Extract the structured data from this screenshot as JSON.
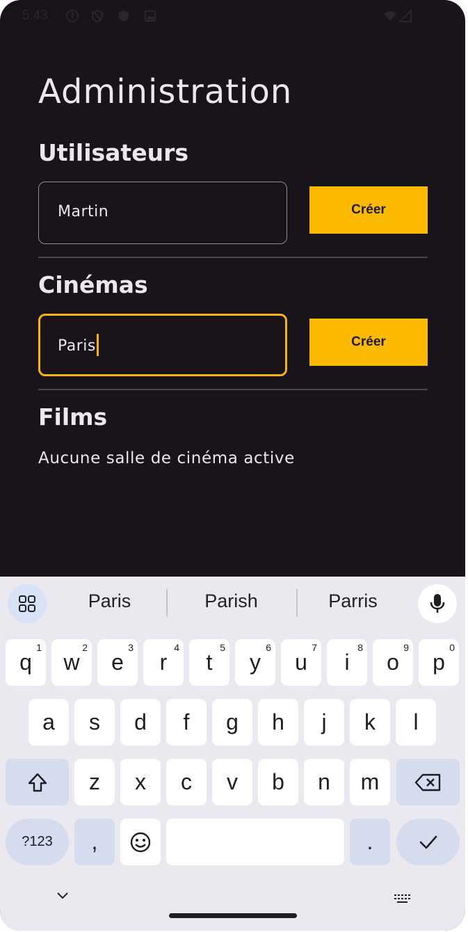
{
  "status_bar": {
    "time": "5:43",
    "icons": [
      "info-circle-icon",
      "shield-icon",
      "vpn-shield-icon",
      "photo-icon",
      "wifi-icon",
      "signal-icon"
    ]
  },
  "app": {
    "title": "Administration",
    "sections": {
      "users": {
        "title": "Utilisateurs",
        "input_value": "Martin",
        "button_label": "Créer"
      },
      "cinemas": {
        "title": "Cinémas",
        "input_value": "Paris",
        "button_label": "Créer"
      },
      "films": {
        "title": "Films",
        "empty_message": "Aucune salle de cinéma active"
      }
    },
    "colors": {
      "background": "#18141a",
      "accent": "#fbba00",
      "focus_border": "#f4b60b"
    }
  },
  "keyboard": {
    "suggestions": [
      "Paris",
      "Parish",
      "Parris"
    ],
    "row1": [
      {
        "key": "q",
        "hint": "1"
      },
      {
        "key": "w",
        "hint": "2"
      },
      {
        "key": "e",
        "hint": "3"
      },
      {
        "key": "r",
        "hint": "4"
      },
      {
        "key": "t",
        "hint": "5"
      },
      {
        "key": "y",
        "hint": "6"
      },
      {
        "key": "u",
        "hint": "7"
      },
      {
        "key": "i",
        "hint": "8"
      },
      {
        "key": "o",
        "hint": "9"
      },
      {
        "key": "p",
        "hint": "0"
      }
    ],
    "row2": [
      "a",
      "s",
      "d",
      "f",
      "g",
      "h",
      "j",
      "k",
      "l"
    ],
    "row3": [
      "z",
      "x",
      "c",
      "v",
      "b",
      "n",
      "m"
    ],
    "symbols_key": "?123",
    "comma_key": ",",
    "period_key": "."
  }
}
